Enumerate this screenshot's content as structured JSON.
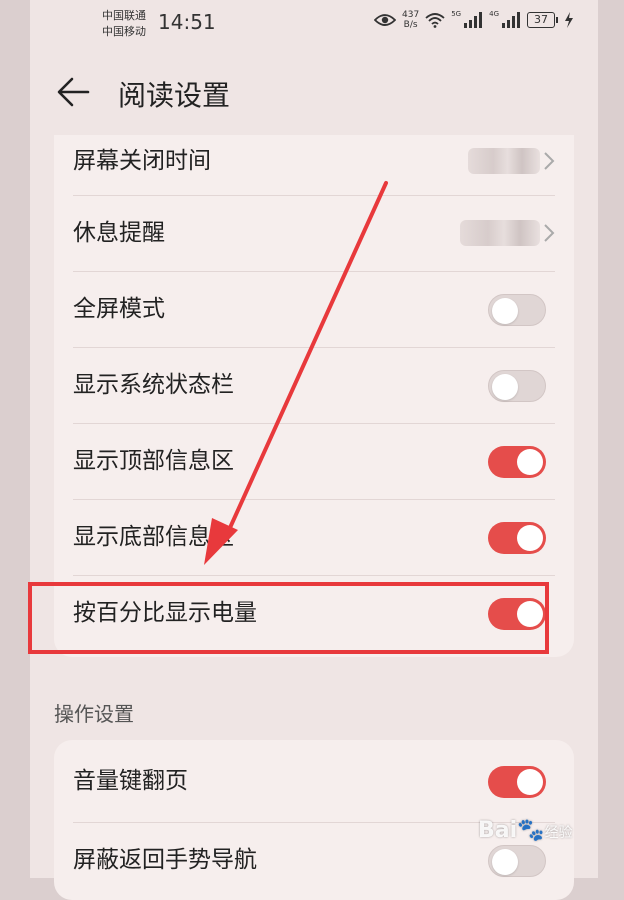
{
  "status_bar": {
    "carrier_1": "中国联通",
    "carrier_2": "中国移动",
    "time": "14:51",
    "net_speed_value": "437",
    "net_speed_unit": "B/s",
    "signal_1_tag": "5G",
    "signal_2_tag": "4G",
    "battery_level": "37"
  },
  "header": {
    "title": "阅读设置"
  },
  "settings": [
    {
      "label": "屏幕关闭时间",
      "control": "value",
      "value": ""
    },
    {
      "label": "休息提醒",
      "control": "value",
      "value": ""
    },
    {
      "label": "全屏模式",
      "control": "toggle",
      "on": false
    },
    {
      "label": "显示系统状态栏",
      "control": "toggle",
      "on": false
    },
    {
      "label": "显示顶部信息区",
      "control": "toggle",
      "on": true
    },
    {
      "label": "显示底部信息区",
      "control": "toggle",
      "on": true
    },
    {
      "label": "按百分比显示电量",
      "control": "toggle",
      "on": true
    }
  ],
  "section_operation": {
    "title": "操作设置",
    "items": [
      {
        "label": "音量键翻页",
        "control": "toggle",
        "on": true
      },
      {
        "label": "屏蔽返回手势导航",
        "control": "toggle",
        "on": false
      }
    ]
  },
  "annotation": {
    "color": "#e8393c",
    "highlighted_item": "按百分比显示电量"
  },
  "watermark": {
    "text": "Bai",
    "suffix": "经验"
  },
  "colors": {
    "toggle_on": "#e54d4b",
    "toggle_off": "#e0d6d5",
    "background": "#efe5e4"
  }
}
